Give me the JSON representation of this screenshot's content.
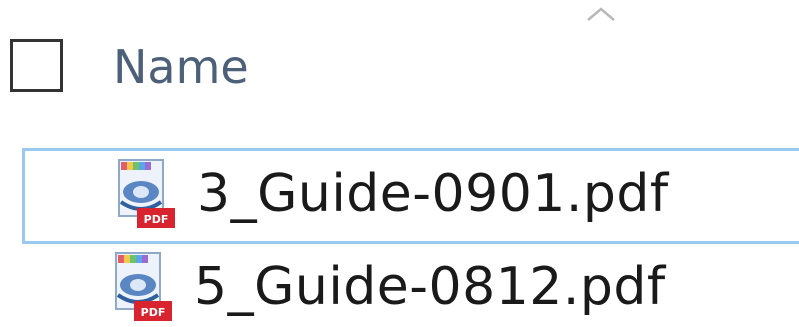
{
  "header": {
    "column_label": "Name",
    "sort_direction": "ascending",
    "sort_icon": "chevron-up-icon",
    "select_all_checked": false
  },
  "files": [
    {
      "name": "3_Guide-0901.pdf",
      "icon": "pdf-file-icon",
      "selected": true
    },
    {
      "name": "5_Guide-0812.pdf",
      "icon": "pdf-file-icon",
      "selected": false
    }
  ],
  "colors": {
    "selection_border": "#99c9ef",
    "header_text": "#4c607a"
  }
}
